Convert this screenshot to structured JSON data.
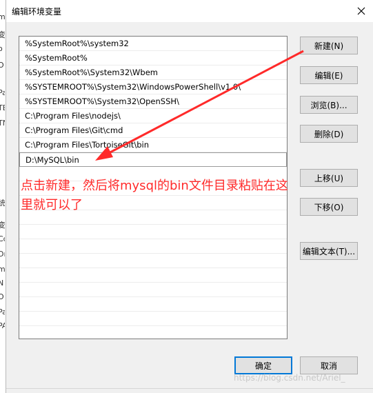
{
  "window": {
    "title": "编辑环境变量"
  },
  "path_entries": [
    "%SystemRoot%\\system32",
    "%SystemRoot%",
    "%SystemRoot%\\System32\\Wbem",
    "%SYSTEMROOT%\\System32\\WindowsPowerShell\\v1.0\\",
    "%SYSTEMROOT%\\System32\\OpenSSH\\",
    "C:\\Program Files\\nodejs\\",
    "C:\\Program Files\\Git\\cmd",
    "C:\\Program Files\\TortoiseGit\\bin",
    "D:\\MySQL\\bin"
  ],
  "buttons": {
    "new": "新建(N)",
    "edit": "编辑(E)",
    "browse": "浏览(B)...",
    "delete": "删除(D)",
    "move_up": "上移(U)",
    "move_down": "下移(O)",
    "edit_text": "编辑文本(T)...",
    "ok": "确定",
    "cancel": "取消"
  },
  "annotation": {
    "text": "点击新建，然后将mysql的bin文件目录粘贴在这里就可以了",
    "color": "#ff2a2a"
  },
  "watermark": "https://blog.csdn.net/Ariel_",
  "background_window_fragments": [
    "m",
    "变",
    "o",
    "O",
    "Pa",
    "TE",
    "TN",
    "统",
    "变",
    "Co",
    "Dr",
    "m",
    "N",
    "O",
    "Pa",
    "PA"
  ],
  "colors": {
    "accent": "#0078d7",
    "annotation": "#ff2a2a"
  }
}
